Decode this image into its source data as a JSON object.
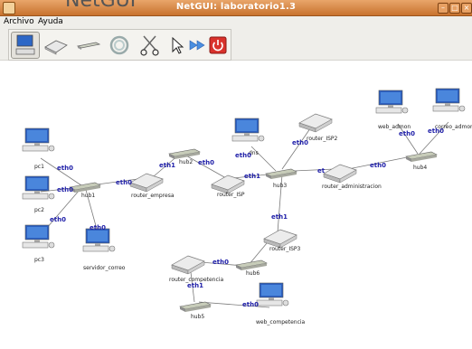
{
  "window": {
    "title": "NetGUI: laboratorio1.3",
    "ghost_title": "NetGUI"
  },
  "menu": {
    "items": [
      "Archivo",
      "Ayuda"
    ]
  },
  "toolbar": {
    "tools": [
      "computer-tool",
      "router-tool",
      "hub-tool",
      "cable-tool",
      "cut-tool",
      "select-tool",
      "play-tool",
      "power-tool"
    ]
  },
  "devices": {
    "pc1": "pc1",
    "pc2": "pc2",
    "pc3": "pc3",
    "servidor_correo": "servidor_correo",
    "hub1": "hub1",
    "router_empresa": "router_empresa",
    "hub2": "hub2",
    "router_ISP": "router_ISP",
    "dns": "dns",
    "router_ISP2": "router_ISP2",
    "hub3": "hub3",
    "router_administracion": "router_administracion",
    "web_admon": "web_admon",
    "correo_admon": "correo_admon",
    "hub4": "hub4",
    "router_ISP3": "router_ISP3",
    "hub6": "hub6",
    "router_competencia": "router_competencia",
    "hub5": "hub5",
    "web_competencia": "web_competencia"
  },
  "interfaces": {
    "eth0": "eth0",
    "eth1": "eth1",
    "eth_partial": "et"
  },
  "colors": {
    "titlebar": "#d9894a",
    "eth_label": "#1e1ea8",
    "cable": "#7a7a7a"
  }
}
